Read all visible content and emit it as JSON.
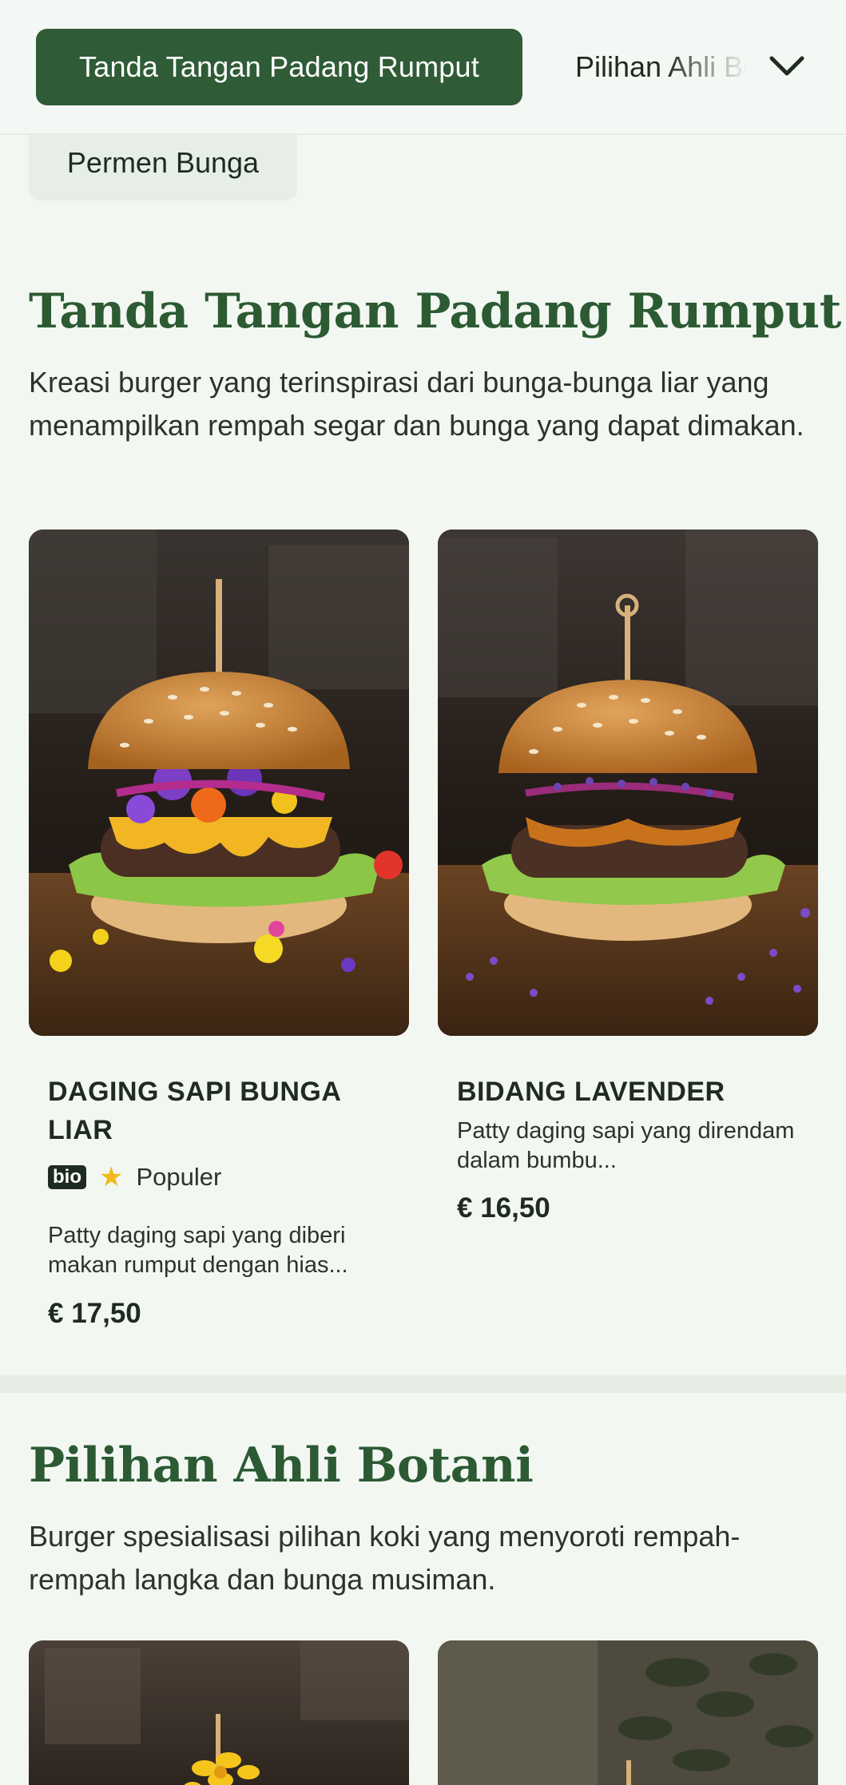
{
  "nav": {
    "active_category": "Tanda Tangan Padang Rumput",
    "next_category": "Pilihan Ahli Botani",
    "previous_category": "Permen Bunga"
  },
  "sections": [
    {
      "title": "Tanda Tangan Padang Rumput",
      "description": "Kreasi burger yang terinspirasi dari bunga-bunga liar yang menampilkan rempah segar dan bunga yang dapat dimakan.",
      "items": [
        {
          "name": "DAGING SAPI BUNGA LIAR",
          "badge": "bio",
          "tag": "Populer",
          "description": "Patty daging sapi yang diberi makan rumput dengan hias...",
          "price": "€ 17,50"
        },
        {
          "name": "BIDANG LAVENDER",
          "description": "Patty daging sapi yang direndam dalam bumbu...",
          "price": "€ 16,50"
        }
      ]
    },
    {
      "title": "Pilihan Ahli Botani",
      "description": "Burger spesialisasi pilihan koki yang menyoroti rempah-rempah langka dan bunga musiman."
    }
  ],
  "icons": {
    "dropdown": "chevron-down-icon",
    "rating": "star-icon"
  },
  "colors": {
    "accent": "#2f5c36",
    "heading": "#2c5a33",
    "background": "#f2f7f2",
    "star": "#f2b71b"
  }
}
